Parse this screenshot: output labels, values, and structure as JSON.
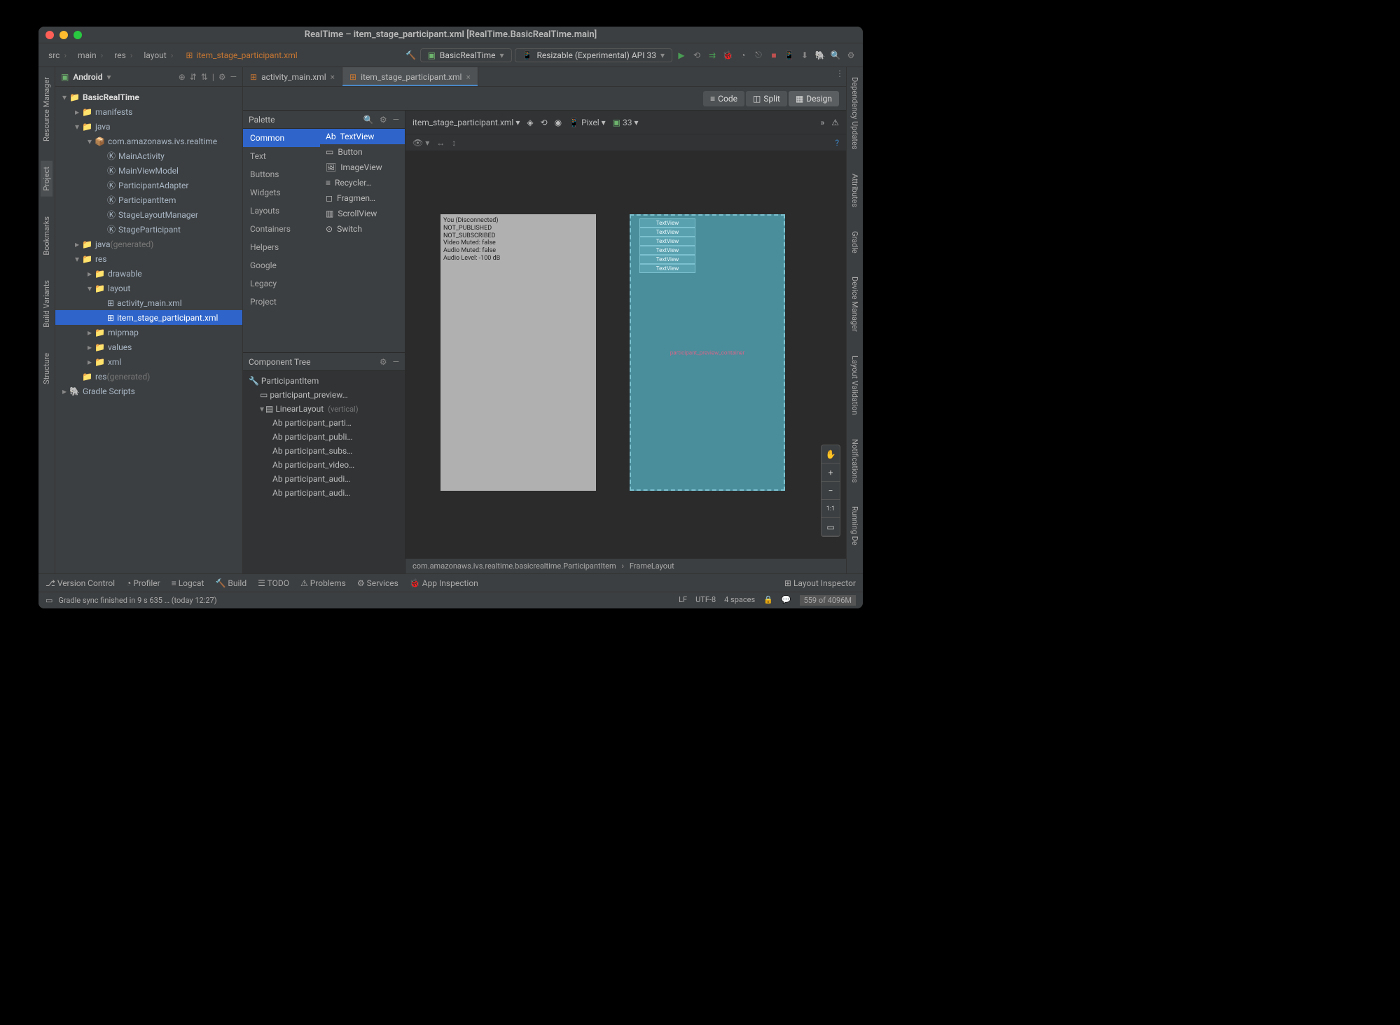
{
  "window": {
    "title": "RealTime – item_stage_participant.xml [RealTime.BasicRealTime.main]"
  },
  "breadcrumbs": [
    "src",
    "main",
    "res",
    "layout",
    "item_stage_participant.xml"
  ],
  "runConfigs": {
    "module": "BasicRealTime",
    "device": "Resizable (Experimental) API 33"
  },
  "projectDropdown": "Android",
  "projectTree": [
    {
      "d": 0,
      "e": "v",
      "ic": "📁",
      "lbl": "BasicRealTime",
      "bold": true
    },
    {
      "d": 1,
      "e": ">",
      "ic": "📁",
      "lbl": "manifests"
    },
    {
      "d": 1,
      "e": "v",
      "ic": "📁",
      "lbl": "java"
    },
    {
      "d": 2,
      "e": "v",
      "ic": "📦",
      "lbl": "com.amazonaws.ivs.realtime"
    },
    {
      "d": 3,
      "e": "",
      "ic": "Ⓚ",
      "lbl": "MainActivity"
    },
    {
      "d": 3,
      "e": "",
      "ic": "Ⓚ",
      "lbl": "MainViewModel"
    },
    {
      "d": 3,
      "e": "",
      "ic": "Ⓚ",
      "lbl": "ParticipantAdapter"
    },
    {
      "d": 3,
      "e": "",
      "ic": "Ⓚ",
      "lbl": "ParticipantItem"
    },
    {
      "d": 3,
      "e": "",
      "ic": "Ⓚ",
      "lbl": "StageLayoutManager"
    },
    {
      "d": 3,
      "e": "",
      "ic": "Ⓚ",
      "lbl": "StageParticipant"
    },
    {
      "d": 1,
      "e": ">",
      "ic": "📁",
      "lbl": "java",
      "suffix": "(generated)"
    },
    {
      "d": 1,
      "e": "v",
      "ic": "📁",
      "lbl": "res"
    },
    {
      "d": 2,
      "e": ">",
      "ic": "📁",
      "lbl": "drawable"
    },
    {
      "d": 2,
      "e": "v",
      "ic": "📁",
      "lbl": "layout"
    },
    {
      "d": 3,
      "e": "",
      "ic": "⊞",
      "lbl": "activity_main.xml"
    },
    {
      "d": 3,
      "e": "",
      "ic": "⊞",
      "lbl": "item_stage_participant.xml",
      "sel": true
    },
    {
      "d": 2,
      "e": ">",
      "ic": "📁",
      "lbl": "mipmap"
    },
    {
      "d": 2,
      "e": ">",
      "ic": "📁",
      "lbl": "values"
    },
    {
      "d": 2,
      "e": ">",
      "ic": "📁",
      "lbl": "xml"
    },
    {
      "d": 1,
      "e": "",
      "ic": "📁",
      "lbl": "res",
      "suffix": "(generated)"
    },
    {
      "d": 0,
      "e": ">",
      "ic": "🐘",
      "lbl": "Gradle Scripts"
    }
  ],
  "tabs": [
    {
      "label": "activity_main.xml",
      "active": false
    },
    {
      "label": "item_stage_participant.xml",
      "active": true
    }
  ],
  "viewModes": {
    "code": "Code",
    "split": "Split",
    "design": "Design"
  },
  "canvasToolbar": {
    "file": "item_stage_participant.xml",
    "device": "Pixel",
    "api": "33"
  },
  "palette": {
    "title": "Palette",
    "categories": [
      "Common",
      "Text",
      "Buttons",
      "Widgets",
      "Layouts",
      "Containers",
      "Helpers",
      "Google",
      "Legacy",
      "Project"
    ],
    "selectedCat": "Common",
    "items": [
      "TextView",
      "Button",
      "ImageView",
      "Recycler…",
      "Fragmen…",
      "ScrollView",
      "Switch"
    ],
    "selectedItem": "TextView"
  },
  "componentTree": {
    "title": "Component Tree",
    "root": "ParticipantItem",
    "nodes": [
      {
        "d": 1,
        "lbl": "participant_preview…",
        "kind": "frame"
      },
      {
        "d": 1,
        "lbl": "LinearLayout",
        "kind": "layout",
        "vert": "(vertical)",
        "exp": "v"
      },
      {
        "d": 2,
        "lbl": "participant_parti…",
        "kind": "ab"
      },
      {
        "d": 2,
        "lbl": "participant_publi…",
        "kind": "ab"
      },
      {
        "d": 2,
        "lbl": "participant_subs…",
        "kind": "ab"
      },
      {
        "d": 2,
        "lbl": "participant_video…",
        "kind": "ab"
      },
      {
        "d": 2,
        "lbl": "participant_audi…",
        "kind": "ab"
      },
      {
        "d": 2,
        "lbl": "participant_audi…",
        "kind": "ab"
      }
    ]
  },
  "preview": {
    "lines": [
      "You (Disconnected)",
      "NOT_PUBLISHED",
      "NOT_SUBSCRIBED",
      "Video Muted: false",
      "Audio Muted: false",
      "Audio Level: -100 dB"
    ],
    "blueprintLabels": [
      "TextView",
      "TextView",
      "TextView",
      "TextView",
      "TextView",
      "TextView"
    ],
    "blueprintCenter": "participant_preview_container"
  },
  "designBreadcrumb": {
    "path": "com.amazonaws.ivs.realtime.basicrealtime.ParticipantItem",
    "tail": "FrameLayout"
  },
  "bottomTabs": [
    "Version Control",
    "Profiler",
    "Logcat",
    "Build",
    "TODO",
    "Problems",
    "Services",
    "App Inspection"
  ],
  "bottomRight": "Layout Inspector",
  "status": {
    "msg": "Gradle sync finished in 9 s 635 … (today 12:27)",
    "lf": "LF",
    "enc": "UTF-8",
    "spaces": "4 spaces",
    "mem": "559 of 4096M"
  },
  "leftTabs": [
    "Resource Manager",
    "Project",
    "Bookmarks",
    "Build Variants",
    "Structure"
  ],
  "rightTabs": [
    "Dependency Updates",
    "Attributes",
    "Gradle",
    "Device Manager",
    "Layout Validation",
    "Notifications",
    "Running De"
  ]
}
